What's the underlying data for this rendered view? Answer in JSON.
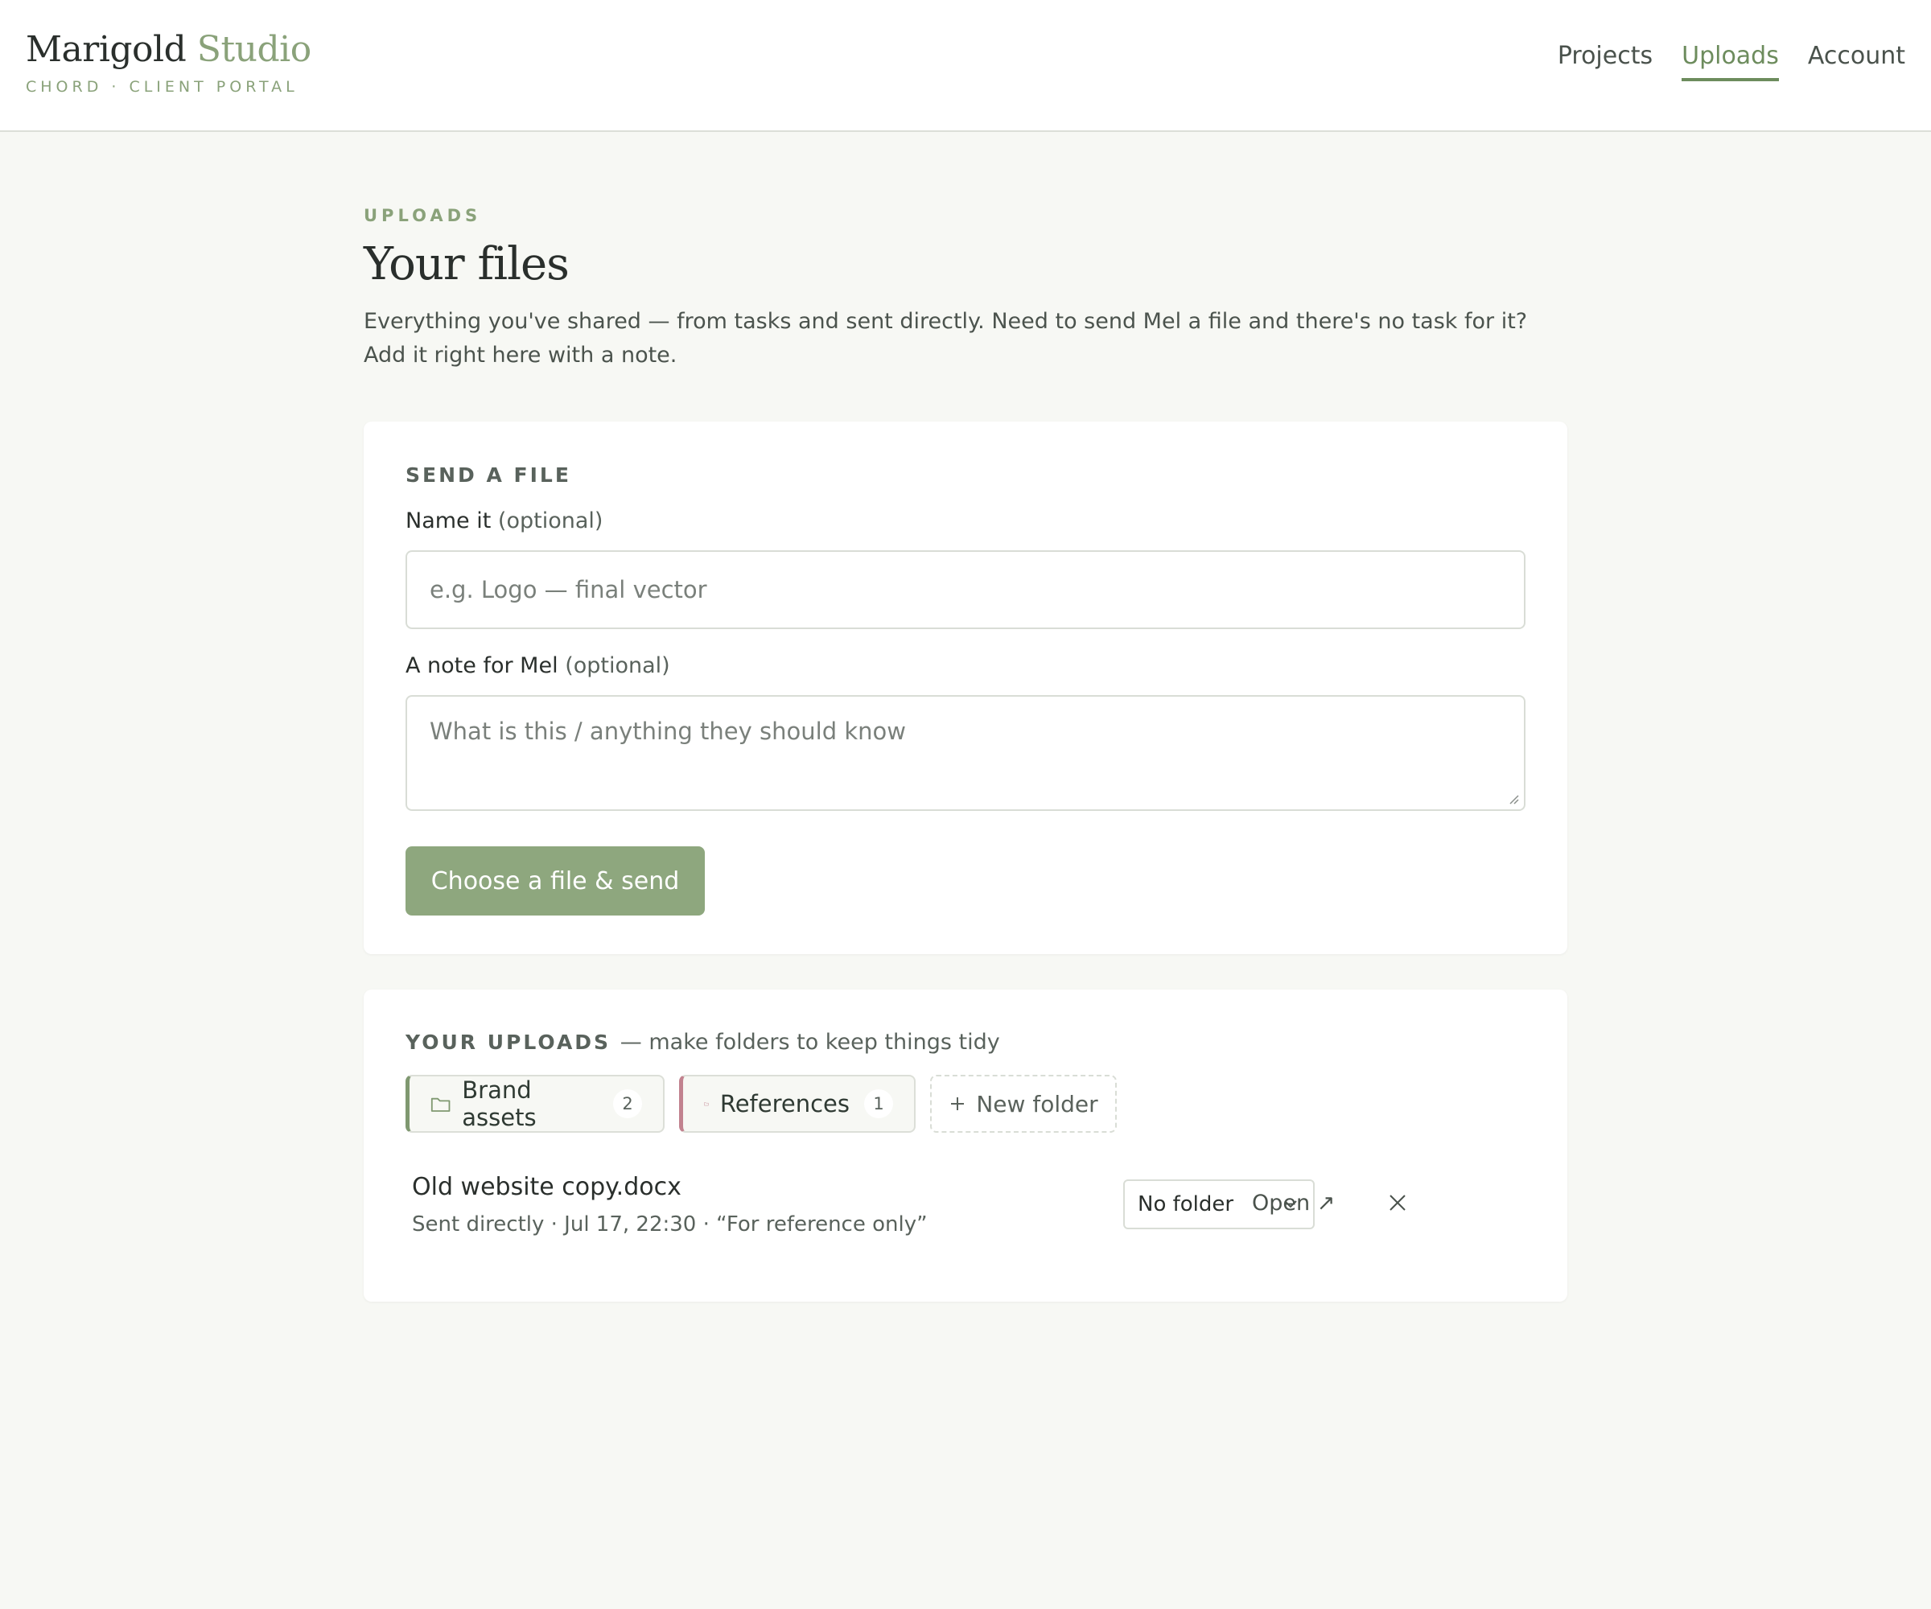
{
  "brand": {
    "name_main": "Marigold",
    "name_accent": "Studio",
    "subtitle": "CHORD · CLIENT PORTAL"
  },
  "nav": {
    "items": [
      {
        "label": "Projects",
        "active": false
      },
      {
        "label": "Uploads",
        "active": true
      },
      {
        "label": "Account",
        "active": false
      }
    ]
  },
  "page": {
    "eyebrow": "UPLOADS",
    "title": "Your files",
    "lead": "Everything you've shared — from tasks and sent directly. Need to send Mel a file and there's no task for it? Add it right here with a note."
  },
  "send_form": {
    "section_title": "SEND A FILE",
    "name_label": "Name it",
    "name_optional": "(optional)",
    "name_placeholder": "e.g. Logo — final vector",
    "note_label": "A note for Mel",
    "note_optional": "(optional)",
    "note_placeholder": "What is this / anything they should know",
    "submit_label": "Choose a file & send"
  },
  "uploads": {
    "section_title": "YOUR UPLOADS",
    "section_hint": "— make folders to keep things tidy",
    "folders": [
      {
        "label": "Brand assets",
        "count": "2",
        "color": "#7f9870",
        "icon": "folder-icon"
      },
      {
        "label": "References",
        "count": "1",
        "color": "#c2828f",
        "icon": "folder-icon"
      }
    ],
    "new_folder_label": "New folder",
    "files": [
      {
        "name": "Old website copy.docx",
        "meta": "Sent directly · Jul 17, 22:30 · “For reference only”",
        "folder_select": "No folder",
        "open_label": "Open ↗",
        "delete_icon": "close-icon"
      }
    ]
  },
  "colors": {
    "accent": "#8aa27a",
    "button": "#8ea77e",
    "background": "#f7f8f4"
  }
}
